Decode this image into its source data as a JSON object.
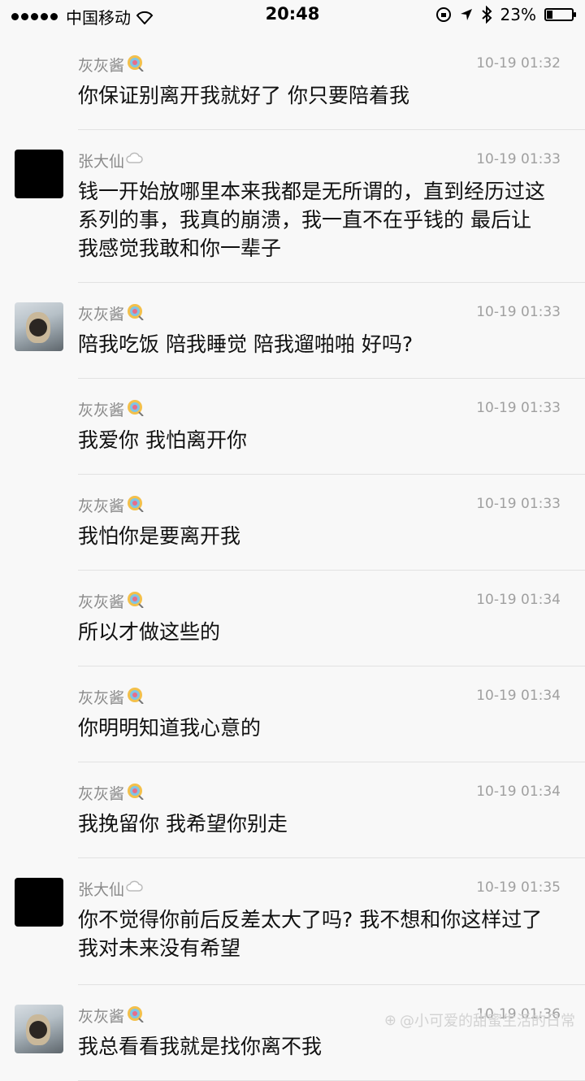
{
  "status_bar": {
    "carrier": "中国移动",
    "time": "20:48",
    "battery": "23%",
    "battery_level": 0.23
  },
  "messages": [
    {
      "sender": "灰灰酱",
      "time": "10-19 01:32",
      "text": "你保证别离开我就好了 你只要陪着我",
      "avatar": "none",
      "badge": "lollipop-icon"
    },
    {
      "sender": "张大仙",
      "time": "10-19 01:33",
      "text": "钱一开始放哪里本来我都是无所谓的，直到经历过这系列的事，我真的崩溃，我一直不在乎钱的  最后让我感觉我敢和你一辈子",
      "avatar": "dark",
      "badge": "cloud-icon"
    },
    {
      "sender": "灰灰酱",
      "time": "10-19 01:33",
      "text": "陪我吃饭 陪我睡觉 陪我遛啪啪 好吗?",
      "avatar": "pug",
      "badge": "lollipop-icon"
    },
    {
      "sender": "灰灰酱",
      "time": "10-19 01:33",
      "text": "我爱你 我怕离开你",
      "avatar": "none",
      "badge": "lollipop-icon"
    },
    {
      "sender": "灰灰酱",
      "time": "10-19 01:33",
      "text": "我怕你是要离开我",
      "avatar": "none",
      "badge": "lollipop-icon"
    },
    {
      "sender": "灰灰酱",
      "time": "10-19 01:34",
      "text": "所以才做这些的",
      "avatar": "none",
      "badge": "lollipop-icon"
    },
    {
      "sender": "灰灰酱",
      "time": "10-19 01:34",
      "text": "你明明知道我心意的",
      "avatar": "none",
      "badge": "lollipop-icon"
    },
    {
      "sender": "灰灰酱",
      "time": "10-19 01:34",
      "text": "我挽留你 我希望你别走",
      "avatar": "none",
      "badge": "lollipop-icon"
    },
    {
      "sender": "张大仙",
      "time": "10-19 01:35",
      "text": "你不觉得你前后反差太大了吗? 我不想和你这样过了 我对未来没有希望",
      "avatar": "dark",
      "badge": "cloud-icon"
    },
    {
      "sender": "灰灰酱",
      "time": "10-19 01:36",
      "text": "我总看看我就是找你离不我",
      "avatar": "pug",
      "badge": "lollipop-icon"
    }
  ],
  "watermark": "@小可爱的甜蜜生活的日常"
}
